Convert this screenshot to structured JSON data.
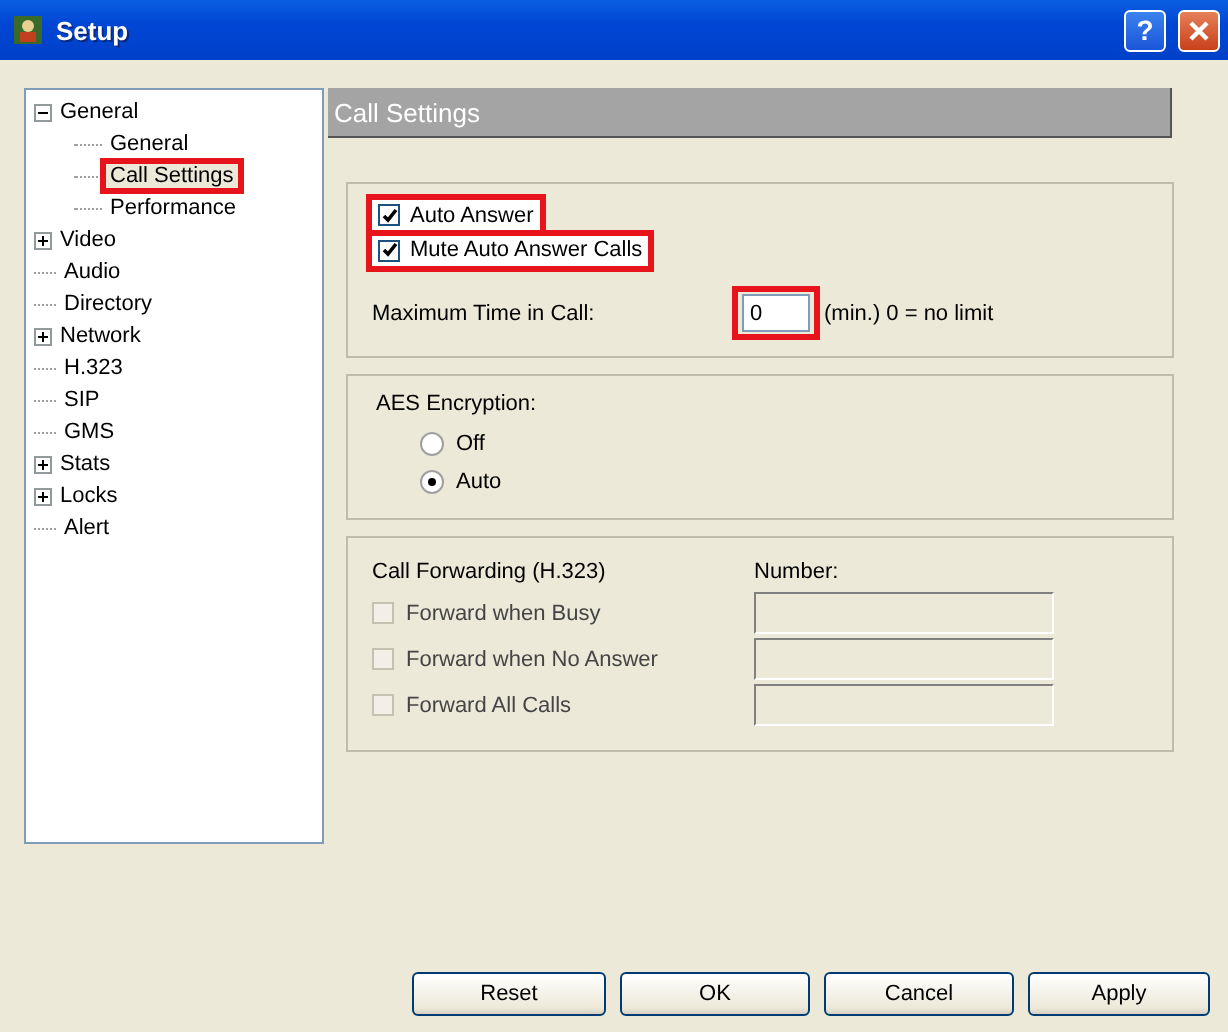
{
  "window": {
    "title": "Setup",
    "help_label": "?"
  },
  "tree": [
    {
      "label": "General",
      "kind": "group",
      "expanded": true,
      "selected": false,
      "highlighted": false,
      "children": [
        {
          "label": "General",
          "selected": false,
          "highlighted": false
        },
        {
          "label": "Call Settings",
          "selected": true,
          "highlighted": true
        },
        {
          "label": "Performance",
          "selected": false,
          "highlighted": false
        }
      ]
    },
    {
      "label": "Video",
      "kind": "group",
      "expanded": false,
      "selected": false,
      "highlighted": false
    },
    {
      "label": "Audio",
      "kind": "leaf",
      "selected": false,
      "highlighted": false
    },
    {
      "label": "Directory",
      "kind": "leaf",
      "selected": false,
      "highlighted": false
    },
    {
      "label": "Network",
      "kind": "group",
      "expanded": false,
      "selected": false,
      "highlighted": false
    },
    {
      "label": "H.323",
      "kind": "leaf",
      "selected": false,
      "highlighted": false
    },
    {
      "label": "SIP",
      "kind": "leaf",
      "selected": false,
      "highlighted": false
    },
    {
      "label": "GMS",
      "kind": "leaf",
      "selected": false,
      "highlighted": false
    },
    {
      "label": "Stats",
      "kind": "group",
      "expanded": false,
      "selected": false,
      "highlighted": false
    },
    {
      "label": "Locks",
      "kind": "group",
      "expanded": false,
      "selected": false,
      "highlighted": false
    },
    {
      "label": "Alert",
      "kind": "leaf",
      "selected": false,
      "highlighted": false
    }
  ],
  "panel_title": "Call Settings",
  "answer_group": {
    "checkboxes": [
      {
        "label": "Auto Answer",
        "checked": true,
        "highlighted": true
      },
      {
        "label": "Mute Auto Answer Calls",
        "checked": true,
        "highlighted": true
      }
    ],
    "max_time": {
      "label": "Maximum Time in Call:",
      "value": "0",
      "highlighted": true,
      "hint": "(min.) 0 = no limit"
    }
  },
  "encryption_group": {
    "label": "AES Encryption:",
    "options": [
      {
        "label": "Off",
        "selected": false
      },
      {
        "label": "Auto",
        "selected": true
      }
    ]
  },
  "forwarding_group": {
    "title": "Call Forwarding (H.323)",
    "number_label": "Number:",
    "rows": [
      {
        "label": "Forward when Busy",
        "checked": false,
        "disabled": true
      },
      {
        "label": "Forward when No Answer",
        "checked": false,
        "disabled": true
      },
      {
        "label": "Forward All Calls",
        "checked": false,
        "disabled": true
      }
    ]
  },
  "buttons": [
    "Reset",
    "OK",
    "Cancel",
    "Apply"
  ]
}
